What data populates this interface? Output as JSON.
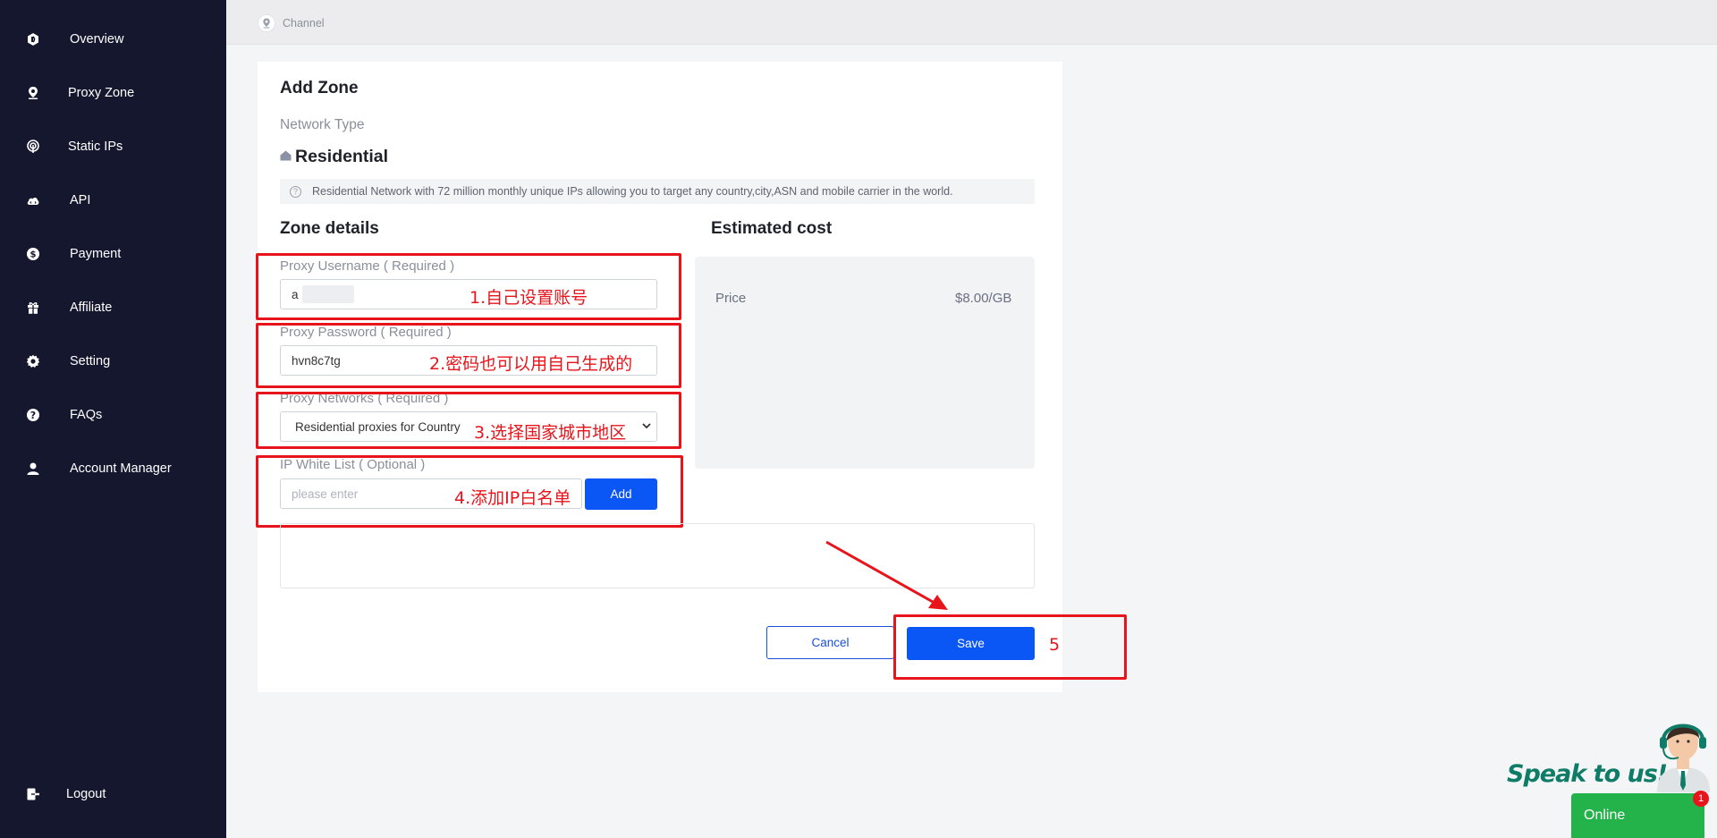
{
  "sidebar": {
    "items": [
      {
        "label": "Overview",
        "icon": "overview-icon"
      },
      {
        "label": "Proxy Zone",
        "icon": "location-pin-icon"
      },
      {
        "label": "Static IPs",
        "icon": "antenna-icon"
      },
      {
        "label": "API",
        "icon": "cloud-icon"
      },
      {
        "label": "Payment",
        "icon": "dollar-icon"
      },
      {
        "label": "Affiliate",
        "icon": "gift-icon"
      },
      {
        "label": "Setting",
        "icon": "gear-icon"
      },
      {
        "label": "FAQs",
        "icon": "question-icon"
      },
      {
        "label": "Account Manager",
        "icon": "user-icon"
      }
    ],
    "logout_label": "Logout"
  },
  "breadcrumb": {
    "label": "Channel"
  },
  "form": {
    "title": "Add Zone",
    "network_type_label": "Network Type",
    "network_type_value": "Residential",
    "network_description": "Residential Network with 72 million monthly unique IPs allowing you to target any country,city,ASN and mobile carrier in the world.",
    "zone_details_title": "Zone details",
    "username_label": "Proxy Username ( Required )",
    "username_value": "a",
    "password_label": "Proxy Password ( Required )",
    "password_value": "hvn8c7tg",
    "networks_label": "Proxy Networks ( Required )",
    "networks_value": "Residential proxies for Country",
    "whitelist_label": "IP White List ( Optional )",
    "whitelist_placeholder": "please enter",
    "add_label": "Add",
    "cancel_label": "Cancel",
    "save_label": "Save"
  },
  "cost": {
    "title": "Estimated cost",
    "price_label": "Price",
    "price_value": "$8.00/GB"
  },
  "annotations": {
    "step1": "1.自己设置账号",
    "step2": "2.密码也可以用自己生成的",
    "step3": "3.选择国家城市地区",
    "step4": "4.添加IP白名单",
    "step5": "5"
  },
  "chat": {
    "speak_label": "Speak to us!",
    "online_label": "Online",
    "badge_count": "1"
  },
  "colors": {
    "sidebar_bg": "#15172f",
    "primary": "#0b57f5",
    "annotation": "#e8141b",
    "online_green": "#24b24a"
  }
}
